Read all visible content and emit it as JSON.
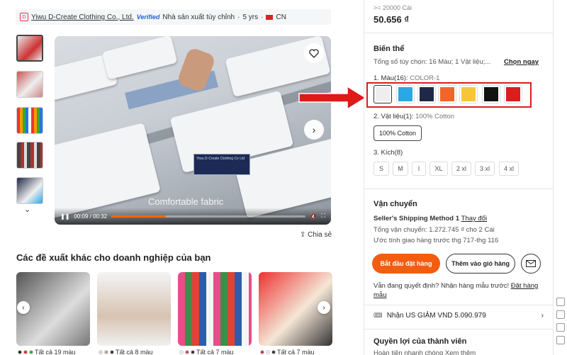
{
  "supplier": {
    "logo_text": "D",
    "name": "Yiwu D-Create Clothing Co., Ltd.",
    "verified": "Verified",
    "type": "Nhà sản xuất tùy chỉnh",
    "years": "5 yrs",
    "country": "CN"
  },
  "video": {
    "caption": "Comfortable fabric",
    "time": "00:09 / 00:32",
    "progress": 0.28,
    "label_text": "Yiwu D-Create Clothing Co Ltd"
  },
  "share_label": "Chia sẻ",
  "recommendations": {
    "title": "Các đề xuất khác cho doanh nghiệp của bạn",
    "cards": [
      {
        "footer": "Tất cả 19 màu",
        "colors": [
          "#222",
          "#c33",
          "#3a3"
        ]
      },
      {
        "footer": "Tất cả 8 màu",
        "colors": [
          "#ddd",
          "#c8a08a",
          "#333"
        ]
      },
      {
        "footer": "Tất cả 7 màu",
        "colors": [
          "#eee",
          "#d44",
          "#333"
        ]
      },
      {
        "footer": "Tất cả 7 màu",
        "colors": [
          "#c33",
          "#eee",
          "#333"
        ]
      }
    ]
  },
  "panel": {
    "tier_qty": ">= 20000 Cái",
    "price": "50.656 ₫",
    "variants_title": "Biến thể",
    "variants_summary": "Tổng số tùy chọn: 16 Màu; 1 Vật liệu;...",
    "choose_now": "Chọn ngay",
    "color_label": "1. Màu(16):",
    "color_value": "COLOR-1",
    "colors": [
      "#eeeeee",
      "#29a7e6",
      "#1f2947",
      "#f2642a",
      "#f5c53c",
      "#121212",
      "#d91e1e"
    ],
    "material_label": "2. Vật liệu(1):",
    "material_value": "100% Cotton",
    "material_chip": "100% Cotton",
    "size_label": "3. Kích(8)",
    "sizes": [
      "S",
      "M",
      "l",
      "XL",
      "2 xl",
      "3 xl",
      "4 xl"
    ],
    "shipping_title": "Vận chuyển",
    "shipping_method": "Seller's Shipping Method 1",
    "change": "Thay đổi",
    "shipping_total": "Tổng vận chuyển: 1.272.745 ₫ cho 2 Cái",
    "delivery": "Ước tính giao hàng trước thg 717-thg 116",
    "btn_order": "Bắt đầu đặt hàng",
    "btn_cart": "Thêm vào giỏ hàng",
    "sample_text": "Vẫn đang quyết định? Nhận hàng mẫu trước!",
    "sample_link": "Đặt hàng mẫu",
    "coupon": "Nhận US GIẢM VND 5.090.979",
    "benefits_title": "Quyền lợi của thành viên",
    "benefits_sub": "Hoàn tiền nhanh chóng Xem thêm"
  },
  "colors": {
    "accent": "#f35d0f",
    "highlight": "#d81e1e",
    "arrow": "#e01919"
  }
}
